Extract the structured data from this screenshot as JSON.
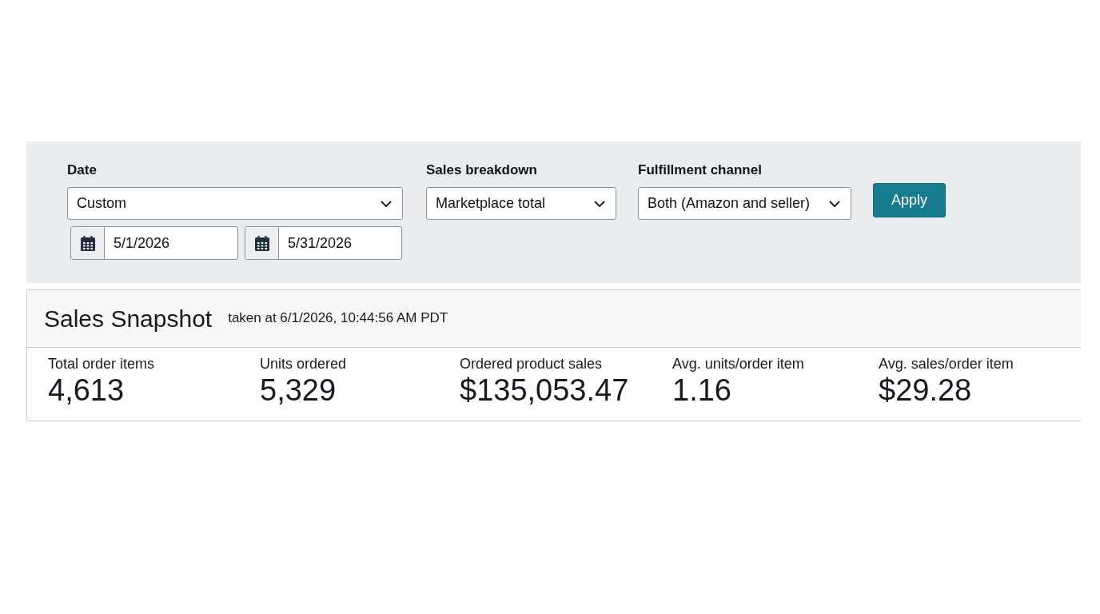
{
  "filters": {
    "date": {
      "label": "Date",
      "value": "Custom",
      "range": [
        "5/1/2026",
        "5/31/2026"
      ]
    },
    "sales_breakdown": {
      "label": "Sales breakdown",
      "value": "Marketplace total"
    },
    "fulfillment_channel": {
      "label": "Fulfillment channel",
      "value": "Both (Amazon and seller)"
    },
    "apply_button": "Apply"
  },
  "snapshot": {
    "title": "Sales Snapshot",
    "taken_at": "taken at 6/1/2026, 10:44:56 AM PDT",
    "metrics": [
      {
        "label": "Total order items",
        "value": "4,613"
      },
      {
        "label": "Units ordered",
        "value": "5,329"
      },
      {
        "label": "Ordered product sales",
        "value": "$135,053.47"
      },
      {
        "label": "Avg. units/order item",
        "value": "1.16"
      },
      {
        "label": "Avg. sales/order item",
        "value": "$29.28"
      }
    ]
  }
}
